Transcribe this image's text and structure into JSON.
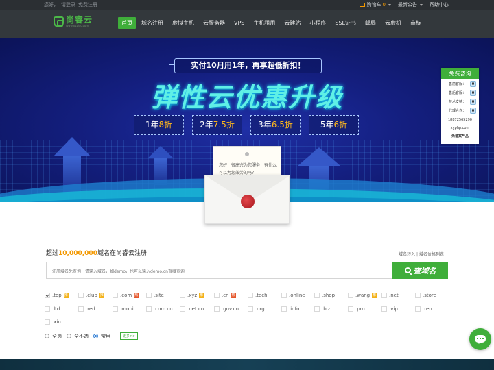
{
  "topbar": {
    "greeting": "您好，",
    "login": "请登录",
    "register": "免费注册",
    "cart": "购物车",
    "cart_count": "0",
    "announcement": "最新公告",
    "help": "帮助中心"
  },
  "brand": {
    "name": "尚睿云",
    "domain": "www.xyzidc.com"
  },
  "nav": {
    "items": [
      "首页",
      "域名注册",
      "虚拟主机",
      "云服务器",
      "VPS",
      "主机租用",
      "云建站",
      "小程序",
      "SSL证书",
      "邮局",
      "云虚机",
      "商标"
    ],
    "active_index": 0,
    "accent": "#3fae3a"
  },
  "banner": {
    "promo": "实付10月用1年，再享超低折扣！",
    "headline": "弹性云优惠升级",
    "offers": [
      {
        "prefix": "1年",
        "discount": "8折"
      },
      {
        "prefix": "2年",
        "discount": "7.5折"
      },
      {
        "prefix": "3年",
        "discount": "6.5折"
      },
      {
        "prefix": "5年",
        "discount": "6折"
      }
    ],
    "letter": "您好！很高兴为您服务，有什么可以为您效劳的吗？"
  },
  "consult": {
    "title": "免费咨询",
    "rows": [
      "售前客服：",
      "售后客服：",
      "技术支持：",
      "代理合作："
    ],
    "phone": "18872565290",
    "site": "xyphp.com",
    "filing": "免备案产品"
  },
  "search": {
    "title_pre": "超过",
    "title_num": "10,000,000",
    "title_post": "域名在尚睿云注册",
    "link_transfer": "域名转入",
    "link_prices": "域名价格列表",
    "placeholder": "注册域名免查询，请输入域名，如demo，也可以输入demo.cn直接查询",
    "button": "查域名"
  },
  "tlds": [
    {
      "name": ".top",
      "badge": "推",
      "checked": true
    },
    {
      "name": ".club",
      "badge": "推",
      "checked": false
    },
    {
      "name": ".com",
      "badge": "热",
      "checked": false
    },
    {
      "name": ".site",
      "badge": "",
      "checked": false
    },
    {
      "name": ".xyz",
      "badge": "推",
      "checked": false
    },
    {
      "name": ".cn",
      "badge": "热",
      "checked": false
    },
    {
      "name": ".tech",
      "badge": "",
      "checked": false
    },
    {
      "name": ".online",
      "badge": "",
      "checked": false
    },
    {
      "name": ".shop",
      "badge": "",
      "checked": false
    },
    {
      "name": ".wang",
      "badge": "推",
      "checked": false
    },
    {
      "name": ".net",
      "badge": "",
      "checked": false
    },
    {
      "name": ".store",
      "badge": "",
      "checked": false
    },
    {
      "name": ".ltd",
      "badge": "",
      "checked": false
    },
    {
      "name": ".red",
      "badge": "",
      "checked": false
    },
    {
      "name": ".mobi",
      "badge": "",
      "checked": false
    },
    {
      "name": ".com.cn",
      "badge": "",
      "checked": false
    },
    {
      "name": ".net.cn",
      "badge": "",
      "checked": false
    },
    {
      "name": ".gov.cn",
      "badge": "",
      "checked": false
    },
    {
      "name": ".org",
      "badge": "",
      "checked": false
    },
    {
      "name": ".info",
      "badge": "",
      "checked": false
    },
    {
      "name": ".biz",
      "badge": "",
      "checked": false
    },
    {
      "name": ".pro",
      "badge": "",
      "checked": false
    },
    {
      "name": ".vip",
      "badge": "",
      "checked": false
    },
    {
      "name": ".ren",
      "badge": "",
      "checked": false
    },
    {
      "name": ".xin",
      "badge": "",
      "checked": false
    }
  ],
  "options": {
    "select_all": "全选",
    "select_none": "全不选",
    "common": "常用",
    "selected": "常用",
    "more": "更多>>"
  },
  "colors": {
    "accent": "#3fae3a",
    "highlight": "#f39800",
    "topbar": "#2b2f33",
    "nav": "#33383c"
  }
}
